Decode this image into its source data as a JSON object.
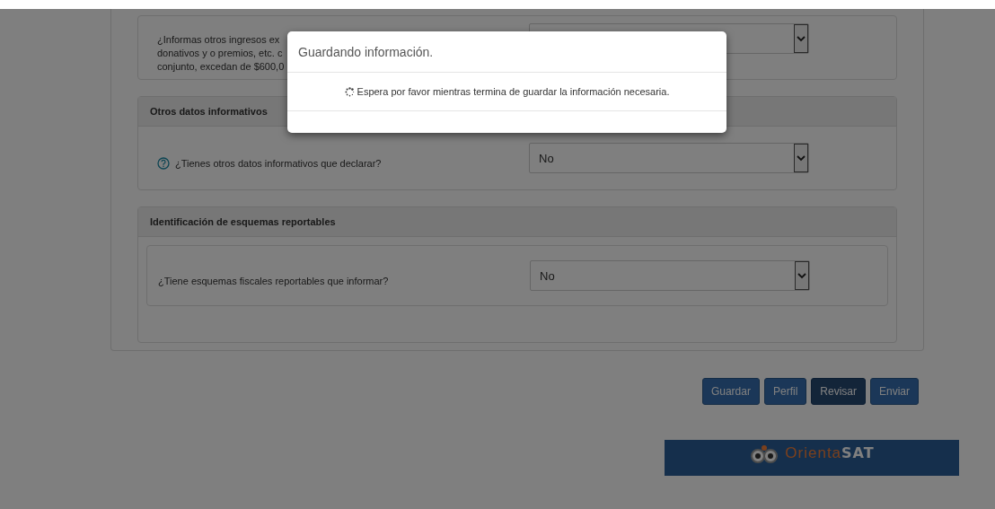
{
  "sections": [
    {
      "boxed": false,
      "question": {
        "lines": [
          "¿Informas otros ingresos ex",
          "donativos y o premios, etc. c",
          "conjunto, excedan de $600,0"
        ]
      }
    },
    {
      "title": "Otros datos informativos",
      "boxed": false,
      "question": {
        "lines": [
          "¿Tienes otros datos informativos que declarar?"
        ],
        "help_icon": true,
        "value": "No"
      }
    },
    {
      "title": "Identificación de esquemas reportables",
      "boxed": true,
      "question": {
        "lines": [
          "¿Tiene esquemas fiscales reportables que informar?"
        ],
        "value": "No"
      }
    }
  ],
  "buttons": [
    {
      "label": "Guardar",
      "selected": false
    },
    {
      "label": "Perfil",
      "selected": false
    },
    {
      "label": "Revisar",
      "selected": true
    },
    {
      "label": "Enviar",
      "selected": false
    }
  ],
  "banner": {
    "text_light": "Orienta",
    "text_bold": "SAT"
  },
  "modal": {
    "title": "Guardando información.",
    "message": "Espera por favor mientras termina de guardar la información necesaria."
  }
}
